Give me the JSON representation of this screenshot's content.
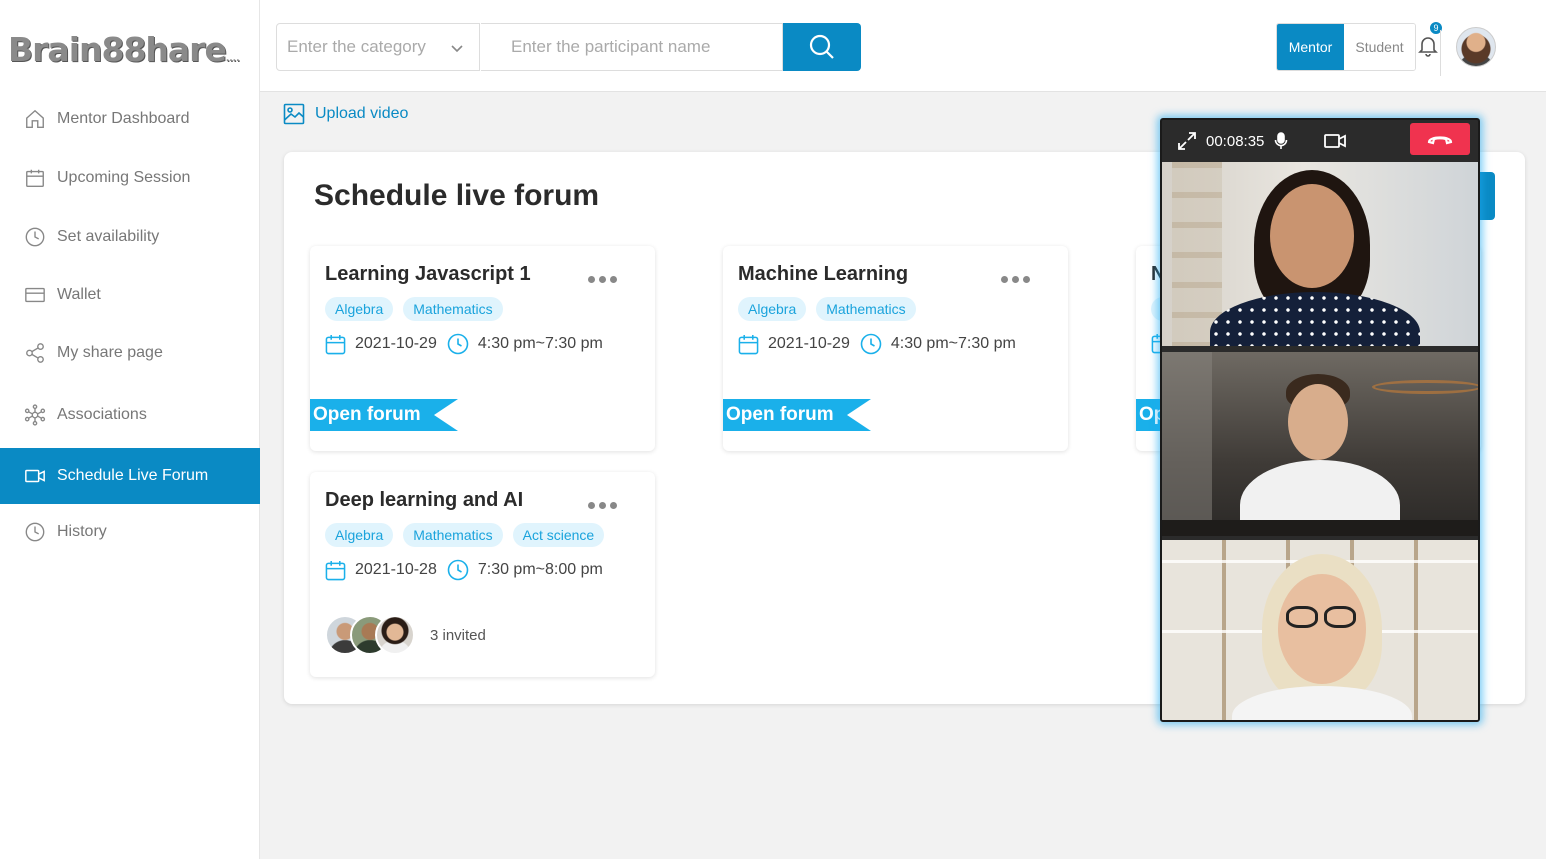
{
  "brand": {
    "logo_main": "Brain88hare",
    "logo_suffix": "...."
  },
  "sidebar": {
    "items": [
      {
        "label": "Mentor Dashboard",
        "icon": "home-icon"
      },
      {
        "label": "Upcoming Session",
        "icon": "calendar-icon"
      },
      {
        "label": "Set availability",
        "icon": "clock-icon"
      },
      {
        "label": "Wallet",
        "icon": "wallet-icon"
      },
      {
        "label": "My share page",
        "icon": "share-icon"
      },
      {
        "label": "Associations",
        "icon": "network-icon"
      },
      {
        "label": "Schedule Live Forum",
        "icon": "video-icon",
        "active": true
      },
      {
        "label": "History",
        "icon": "clock-icon"
      }
    ]
  },
  "header": {
    "category_placeholder": "Enter the category",
    "participant_placeholder": "Enter the participant name",
    "role_mentor": "Mentor",
    "role_student": "Student",
    "notification_count": "9"
  },
  "upload_label": "Upload video",
  "page_title": "Schedule live forum",
  "forums": [
    {
      "title": "Learning Javascript 1",
      "tags": [
        "Algebra",
        "Mathematics"
      ],
      "date": "2021-10-29",
      "time": "4:30 pm~7:30 pm",
      "action": "Open forum"
    },
    {
      "title": "Machine Learning",
      "tags": [
        "Algebra",
        "Mathematics"
      ],
      "date": "2021-10-29",
      "time": "4:30 pm~7:30 pm",
      "action": "Open forum"
    },
    {
      "title": "N",
      "action": "Op"
    },
    {
      "title": "Deep learning and AI",
      "tags": [
        "Algebra",
        "Mathematics",
        "Act science"
      ],
      "date": "2021-10-28",
      "time": "7:30 pm~8:00 pm",
      "invited": "3 invited"
    }
  ],
  "call": {
    "timer": "00:08:35"
  },
  "colors": {
    "accent": "#0a8ac4",
    "ribbon": "#1ab0ea",
    "end_call": "#f0334f"
  }
}
